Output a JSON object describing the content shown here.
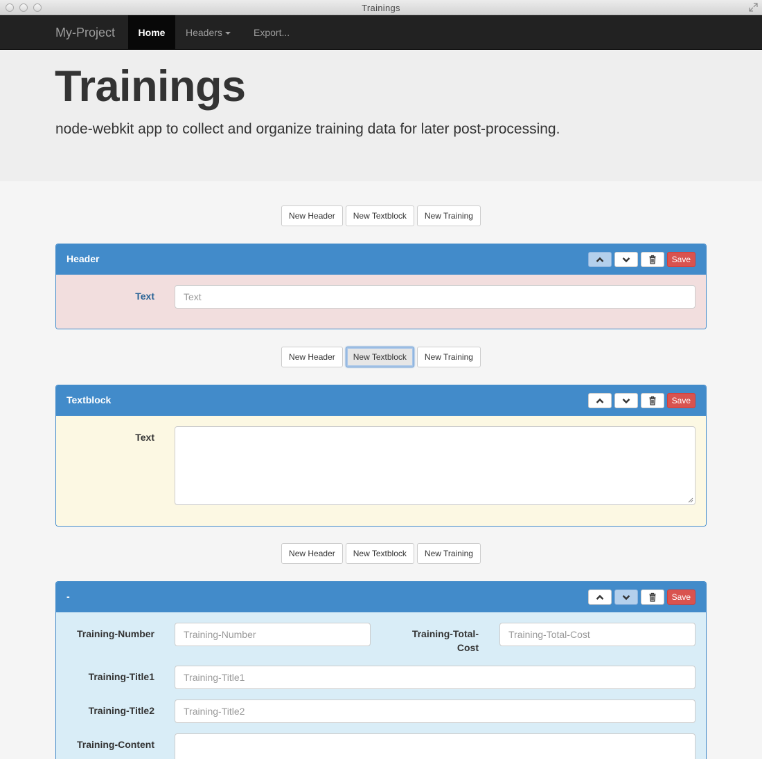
{
  "window": {
    "title": "Trainings"
  },
  "navbar": {
    "brand": "My-Project",
    "items": [
      {
        "label": "Home",
        "active": true
      },
      {
        "label": "Headers",
        "dropdown": true
      },
      {
        "label": "Export..."
      }
    ]
  },
  "jumbotron": {
    "title": "Trainings",
    "subtitle": "node-webkit app to collect and organize training data for later post-processing."
  },
  "add_buttons": {
    "new_header": "New Header",
    "new_textblock": "New Textblock",
    "new_training": "New Training"
  },
  "panel_controls": {
    "save": "Save",
    "icons": [
      "chevron-up-icon",
      "chevron-down-icon",
      "trash-icon"
    ]
  },
  "header_panel": {
    "title": "Header",
    "text_label": "Text",
    "text_placeholder": "Text",
    "text_value": ""
  },
  "textblock_panel": {
    "title": "Textblock",
    "text_label": "Text",
    "text_value": ""
  },
  "training_panel": {
    "title": "-",
    "number_label": "Training-Number",
    "number_placeholder": "Training-Number",
    "total_cost_label_1": "Training-Total-",
    "total_cost_label_2": "Cost",
    "total_cost_placeholder": "Training-Total-Cost",
    "title1_label": "Training-Title1",
    "title1_placeholder": "Training-Title1",
    "title2_label": "Training-Title2",
    "title2_placeholder": "Training-Title2",
    "content_label": "Training-Content"
  },
  "colors": {
    "panel_primary": "#428bca",
    "save": "#d9534f",
    "navbar": "#222222",
    "danger_bg": "#f2dede",
    "warning_bg": "#fcf8e3",
    "info_bg": "#d9edf7"
  }
}
